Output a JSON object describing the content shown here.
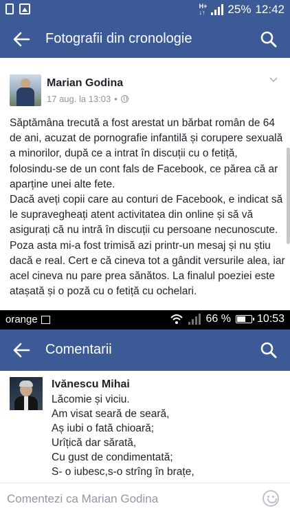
{
  "status_bar_top": {
    "battery": "25%",
    "time": "12:42",
    "icons": [
      "sim-icon",
      "gallery-icon",
      "ht-icon",
      "signal-icon"
    ]
  },
  "toolbar_top": {
    "title": "Fotografii din cronologie",
    "back_icon": "arrow-left-icon",
    "search_icon": "search-icon"
  },
  "post": {
    "author": "Marian Godina",
    "date": "17 aug. la 13:03",
    "separator": "•",
    "privacy_icon": "globe-icon",
    "menu_icon": "chevron-down-icon",
    "paragraphs": [
      "Săptămâna trecută a fost arestat un bărbat român de 64 de ani, acuzat de pornografie infantilă și corupere sexuală a minorilor, după ce a intrat în discuții cu o fetiță, folosindu-se de un cont fals de Facebook, ce părea că ar aparține unei alte fete.",
      "Dacă aveți copii care au conturi de Facebook, e indicat să le supravegheați atent activitatea din online și să vă asigurați că nu intră în discuții cu persoane necunoscute.",
      "Poza asta mi-a fost trimisă azi printr-un mesaj și nu știu dacă e real. Cert e că cineva tot a gândit versurile alea, iar acel cineva nu pare prea sănătos. La finalul poeziei este atașată și o poză cu o fetiță cu ochelari."
    ]
  },
  "status_bar_bottom": {
    "carrier": "orange",
    "battery": "66 %",
    "time": "10:53",
    "battery_level": 0.66
  },
  "toolbar_bottom": {
    "title": "Comentarii",
    "back_icon": "arrow-left-icon",
    "search_icon": "search-icon"
  },
  "comment": {
    "author": "Ivănescu Mihai",
    "lines": [
      "Lăcomie și viciu.",
      "Am visat seară de seară,",
      "Aș iubi o fată chioară;",
      "Urîțică dar sărată,",
      "Cu gust de condimentată;",
      "S- o iubesc,s-o strîng în brațe,"
    ]
  },
  "compose": {
    "placeholder": "Comentezi ca Marian Godina",
    "emoji_icon": "smiley-icon"
  },
  "colors": {
    "facebook_blue": "#3c5a96",
    "text": "#1d2129",
    "meta": "#90949c"
  }
}
